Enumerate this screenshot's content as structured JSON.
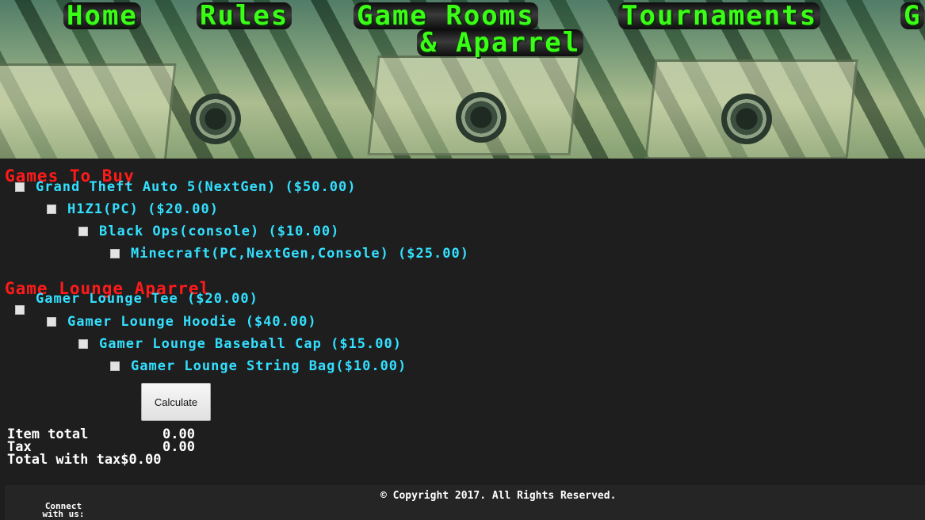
{
  "nav": {
    "items": [
      "Home",
      "Rules",
      "Game Rooms",
      "Tournaments",
      "G"
    ],
    "second_line": "& Aparrel"
  },
  "games": {
    "title": "Games To Buy",
    "items": [
      "Grand Theft Auto 5(NextGen) ($50.00)",
      "H1Z1(PC) ($20.00)",
      "Black Ops(console) ($10.00)",
      "Minecraft(PC,NextGen,Console) ($25.00)"
    ]
  },
  "apparel": {
    "title": "Game Lounge Aparrel",
    "items": [
      "Gamer Lounge Tee ($20.00)",
      "Gamer Lounge Hoodie ($40.00)",
      "Gamer Lounge Baseball Cap ($15.00)",
      "Gamer Lounge String Bag($10.00)"
    ]
  },
  "calculate_label": "Calculate",
  "totals": {
    "item_total_label": "Item total",
    "item_total_value": "0.00",
    "tax_label": "Tax",
    "tax_value": "0.00",
    "total_label": "Total with tax",
    "total_value": "$0.00"
  },
  "footer": {
    "copyright": "© Copyright 2017. All Rights Reserved.",
    "connect_line1": "Connect",
    "connect_line2": "with us:"
  },
  "colors": {
    "nav_text": "#39ff14",
    "section_title": "#ff1a1a",
    "item_text": "#33e0ff",
    "background": "#1e1e1e"
  }
}
